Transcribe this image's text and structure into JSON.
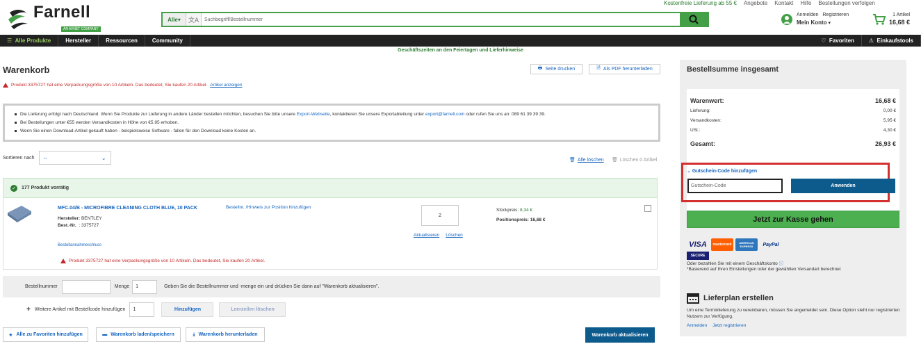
{
  "top_strip": {
    "free_delivery": "Kostenfreie Lieferung ab 55 €",
    "links": [
      "Angebote",
      "Kontakt",
      "Hilfe",
      "Bestellungen verfolgen"
    ]
  },
  "brand": {
    "name": "Farnell",
    "tagline": "AN AVNET COMPANY",
    "color": "#43a047"
  },
  "search": {
    "category": "Alle",
    "placeholder": "Suchbegriff/Bestellnummer",
    "icon": "search-icon"
  },
  "account": {
    "login": "Anmelden",
    "register": "Registrieren",
    "my_account": "Mein Konto"
  },
  "cart": {
    "items": "1 Artikel",
    "total": "16,68 €"
  },
  "nav": {
    "all_products": "Alle Produkte",
    "items": [
      "Hersteller",
      "Ressourcen",
      "Community"
    ],
    "favorites": "Favoriten",
    "purchasing_tools": "Einkaufstools"
  },
  "holiday_notice": "Geschäftszeiten an den Feiertagen und Lieferhinweise",
  "page": {
    "title": "Warenkorb",
    "print": "Seite drucken",
    "pdf": "Als PDF herunterladen",
    "warning": "Produkt 3375727 hat eine Verpackungsgröße von 10 Artikeln. Das bedeutet, Sie kaufen 20 Artikel.",
    "warning_link": "Artikel anzeigen"
  },
  "info": {
    "line1_a": "Die Lieferung erfolgt nach Deutschland. Wenn Sie Produkte zur Lieferung in andere Länder bestellen möchten, besuchen Sie bitte unsere ",
    "line1_link": "Export-Webseite",
    "line1_b": ", kontaktieren Sie unsere Exportabteilung unter ",
    "line1_email": "export@farnell.com",
    "line1_c": " oder rufen Sie uns an: 089 61 39 39 39.",
    "line2": "Bei Bestellungen unter €55 werden Versandkosten in Höhe von €5.95 erhoben.",
    "line3": "Wenn Sie einen Download-Artikel gekauft haben - beispielsweise Software - fallen für den Download keine Kosten an."
  },
  "sort": {
    "label": "Sortieren nach",
    "value": "--"
  },
  "bulk": {
    "delete_all": "Alle löschen",
    "delete_n": "Löschen 0 Artikel"
  },
  "stock": {
    "text": "177 Produkt vorrätig"
  },
  "product": {
    "name": "MFC.04/B - MICROFIBRE CLEANING CLOTH BLUE, 10 PACK",
    "mfr_label": "Hersteller:",
    "mfr": "BENTLEY",
    "order_label": "Best.-Nr.",
    "order_no": ": 3375727",
    "note_link": "Bestellnr. /Hinweis zur Position hinzufügen",
    "qty": "2",
    "update": "Aktualisieren",
    "delete": "Löschen",
    "unit_label": "Stückpreis:",
    "unit_price": "8,34 €",
    "pos_label": "Positionspreis:",
    "pos_price": "16,68 €",
    "exclusion": "Bestellannahmeschluss",
    "warning": "Produkt 3375727 hat eine Verpackungsgröße von 10 Artikeln. Das bedeutet, Sie kaufen 20 Artikel."
  },
  "quick_add": {
    "order_label": "Bestellnummer",
    "qty_label": "Menge",
    "qty_value": "1",
    "hint": "Geben Sie die Bestellnummer und -menge ein und drücken Sie dann auf \"Warenkorb aktualisieren\".",
    "more_label": "Weitere Artikel mit Bestellcode hinzufügen",
    "more_value": "1",
    "add": "Hinzufügen",
    "clear": "Leerzeilen löschen"
  },
  "bottom": {
    "fav_all": "Alle zu Favoriten hinzufügen",
    "load_save": "Warenkorb laden/speichern",
    "download": "Warenkorb herunterladen",
    "update_cart": "Warenkorb aktualisieren"
  },
  "summary": {
    "title": "Bestellsumme insgesamt",
    "goods_label": "Warenwert:",
    "goods": "16,68 €",
    "delivery_label": "Lieferung:",
    "delivery": "0,00 €",
    "shipping_label": "Versandkosten:",
    "shipping": "5,95 €",
    "vat_label": "USt.:",
    "vat": "4,30 €",
    "total_label": "Gesamt:",
    "total": "26,93 €",
    "coupon_label": "Gutschein-Code hinzufügen",
    "coupon_placeholder": "Gutschein-Code",
    "apply": "Anwenden",
    "checkout": "Jetzt zur Kasse gehen",
    "pay_note1": "Oder bezahlen Sie mit einem Geschäftskonto",
    "pay_note2": "*Basierend auf Ihren Einstellungen oder der gewählten Versandart berechnet",
    "payment": [
      "VISA",
      "mastercard",
      "AMERICAN EXPRESS",
      "PayPal",
      "SECURE"
    ]
  },
  "plan": {
    "title": "Lieferplan erstellen",
    "text": "Um eine Terminlieferung zu vereinbaren, müssen Sie angemeldet sein. Diese Option steht nur registrierten Nutzern zur Verfügung.",
    "login": "Anmelden",
    "register": "Jetzt registrieren"
  },
  "colors": {
    "accent_green": "#43a047",
    "dark_blue": "#0d5a8c",
    "link_blue": "#1565c0",
    "warn_red": "#c62828",
    "highlight_red": "#d32f2f"
  }
}
